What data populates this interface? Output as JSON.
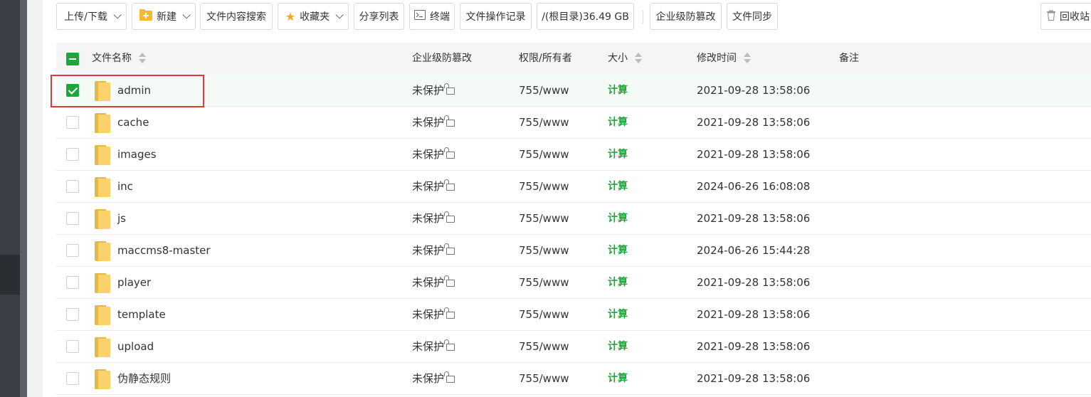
{
  "toolbar": {
    "upload_download": "上传/下载",
    "new": "新建",
    "content_search": "文件内容搜索",
    "favorites": "收藏夹",
    "share_list": "分享列表",
    "terminal": "终端",
    "op_log": "文件操作记录",
    "disk": "/(根目录)36.49 GB",
    "tamper": "企业级防篡改",
    "sync": "文件同步",
    "recycle": "回收站"
  },
  "table": {
    "headers": {
      "name": "文件名称",
      "tamper": "企业级防篡改",
      "perm": "权限/所有者",
      "size": "大小",
      "mtime": "修改时间",
      "remark": "备注"
    },
    "rows": [
      {
        "name": "admin",
        "protect": "未保护",
        "perm": "755/www",
        "size": "计算",
        "mtime": "2021-09-28 13:58:06",
        "checked": true
      },
      {
        "name": "cache",
        "protect": "未保护",
        "perm": "755/www",
        "size": "计算",
        "mtime": "2021-09-28 13:58:06",
        "checked": false
      },
      {
        "name": "images",
        "protect": "未保护",
        "perm": "755/www",
        "size": "计算",
        "mtime": "2021-09-28 13:58:06",
        "checked": false
      },
      {
        "name": "inc",
        "protect": "未保护",
        "perm": "755/www",
        "size": "计算",
        "mtime": "2024-06-26 16:08:08",
        "checked": false
      },
      {
        "name": "js",
        "protect": "未保护",
        "perm": "755/www",
        "size": "计算",
        "mtime": "2021-09-28 13:58:06",
        "checked": false
      },
      {
        "name": "maccms8-master",
        "protect": "未保护",
        "perm": "755/www",
        "size": "计算",
        "mtime": "2024-06-26 15:44:28",
        "checked": false
      },
      {
        "name": "player",
        "protect": "未保护",
        "perm": "755/www",
        "size": "计算",
        "mtime": "2021-09-28 13:58:06",
        "checked": false
      },
      {
        "name": "template",
        "protect": "未保护",
        "perm": "755/www",
        "size": "计算",
        "mtime": "2021-09-28 13:58:06",
        "checked": false
      },
      {
        "name": "upload",
        "protect": "未保护",
        "perm": "755/www",
        "size": "计算",
        "mtime": "2021-09-28 13:58:06",
        "checked": false
      },
      {
        "name": "伪静态规则",
        "protect": "未保护",
        "perm": "755/www",
        "size": "计算",
        "mtime": "2021-09-28 13:58:06",
        "checked": false
      }
    ]
  },
  "colors": {
    "accent": "#20a53a",
    "highlight": "#e53935",
    "folder": "#fdd26a"
  },
  "icons": {
    "new": "folder-plus-icon",
    "favorites": "star-icon",
    "terminal": "terminal-icon",
    "recycle": "trash-icon",
    "lock": "unlock-icon"
  }
}
